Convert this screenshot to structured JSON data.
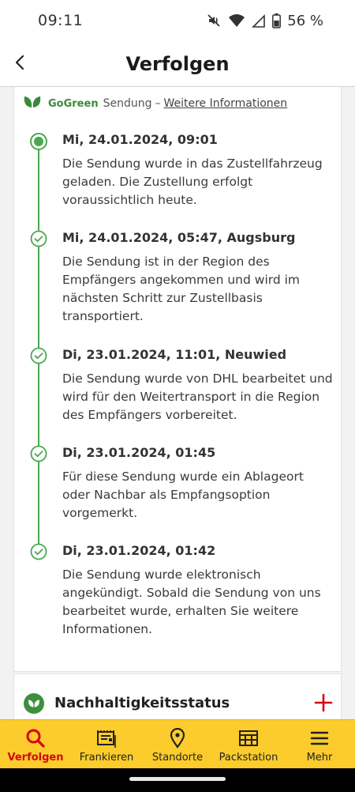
{
  "status_bar": {
    "time": "09:11",
    "battery": "56 %"
  },
  "header": {
    "title": "Verfolgen"
  },
  "gogreen": {
    "brand": "GoGreen",
    "label": "Sendung",
    "separator": "–",
    "link": "Weitere Informationen"
  },
  "events": [
    {
      "date": "Mi, 24.01.2024, 09:01",
      "description": "Die Sendung wurde in das Zustellfahrzeug geladen. Die Zustellung erfolgt voraussichtlich heute."
    },
    {
      "date": "Mi, 24.01.2024, 05:47, Augsburg",
      "description": "Die Sendung ist in der Region des Empfängers angekommen und wird im nächsten Schritt zur Zustellbasis transportiert."
    },
    {
      "date": "Di, 23.01.2024, 11:01, Neuwied",
      "description": "Die Sendung wurde von DHL bearbeitet und wird für den Weitertransport in die Region des Empfängers vorbereitet."
    },
    {
      "date": "Di, 23.01.2024, 01:45",
      "description": "Für diese Sendung wurde ein Ablageort oder Nachbar als Empfangsoption vorgemerkt."
    },
    {
      "date": "Di, 23.01.2024, 01:42",
      "description": "Die Sendung wurde elektronisch angekündigt. Sobald die Sendung von uns bearbeitet wurde, erhalten Sie weitere Informationen."
    }
  ],
  "sustainability": {
    "title": "Nachhaltigkeitsstatus"
  },
  "nav": {
    "items": [
      {
        "label": "Verfolgen",
        "icon": "search-icon",
        "active": true
      },
      {
        "label": "Frankieren",
        "icon": "stamp-icon",
        "active": false
      },
      {
        "label": "Standorte",
        "icon": "location-pin-icon",
        "active": false
      },
      {
        "label": "Packstation",
        "icon": "packstation-icon",
        "active": false
      },
      {
        "label": "Mehr",
        "icon": "menu-icon",
        "active": false
      }
    ]
  },
  "colors": {
    "accent_green": "#4aa84f",
    "dhl_yellow": "#fbcc2b",
    "dhl_red": "#d40511"
  }
}
